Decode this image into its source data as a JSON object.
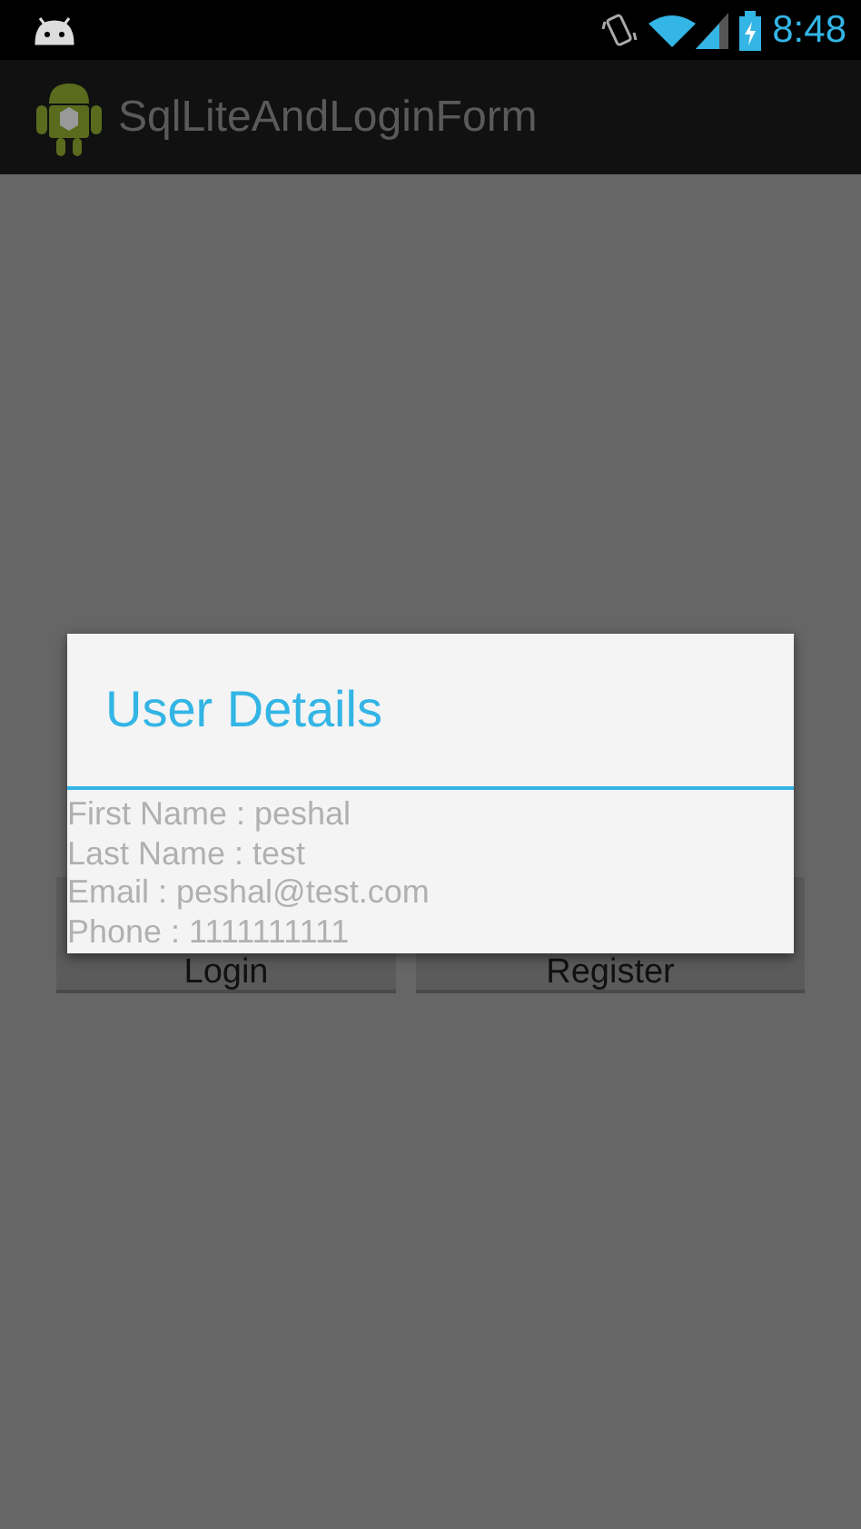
{
  "status_bar": {
    "time": "8:48"
  },
  "action_bar": {
    "title": "SqlLiteAndLoginForm"
  },
  "buttons": [
    {
      "label": "Login"
    },
    {
      "label": "Register"
    }
  ],
  "dialog": {
    "title": "User Details",
    "lines": [
      "First Name : peshal",
      "Last Name : test",
      "Email : peshal@test.com",
      "Phone : 1111111111"
    ]
  }
}
